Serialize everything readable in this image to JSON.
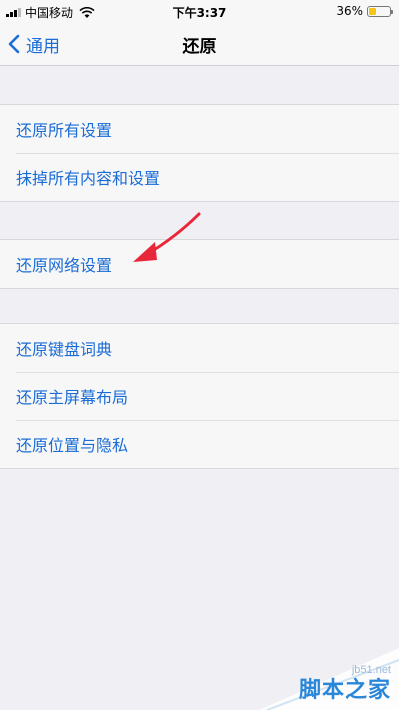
{
  "status_bar": {
    "carrier": "中国移动",
    "time": "下午3:37",
    "battery": "36%",
    "battery_level": 0.36,
    "battery_color": "#f5c518"
  },
  "nav": {
    "back_label": "通用",
    "title": "还原"
  },
  "groups": [
    {
      "items": [
        "还原所有设置",
        "抹掉所有内容和设置"
      ]
    },
    {
      "items": [
        "还原网络设置"
      ]
    },
    {
      "items": [
        "还原键盘词典",
        "还原主屏幕布局",
        "还原位置与隐私"
      ]
    }
  ],
  "annotation": {
    "icon": "red-arrow-icon",
    "color": "#e8283a"
  },
  "watermark": {
    "site": "jb51.net",
    "text": "脚本之家"
  },
  "colors": {
    "accent": "#1a6cd6",
    "background": "#efeff4",
    "cell": "#f7f7f7"
  }
}
